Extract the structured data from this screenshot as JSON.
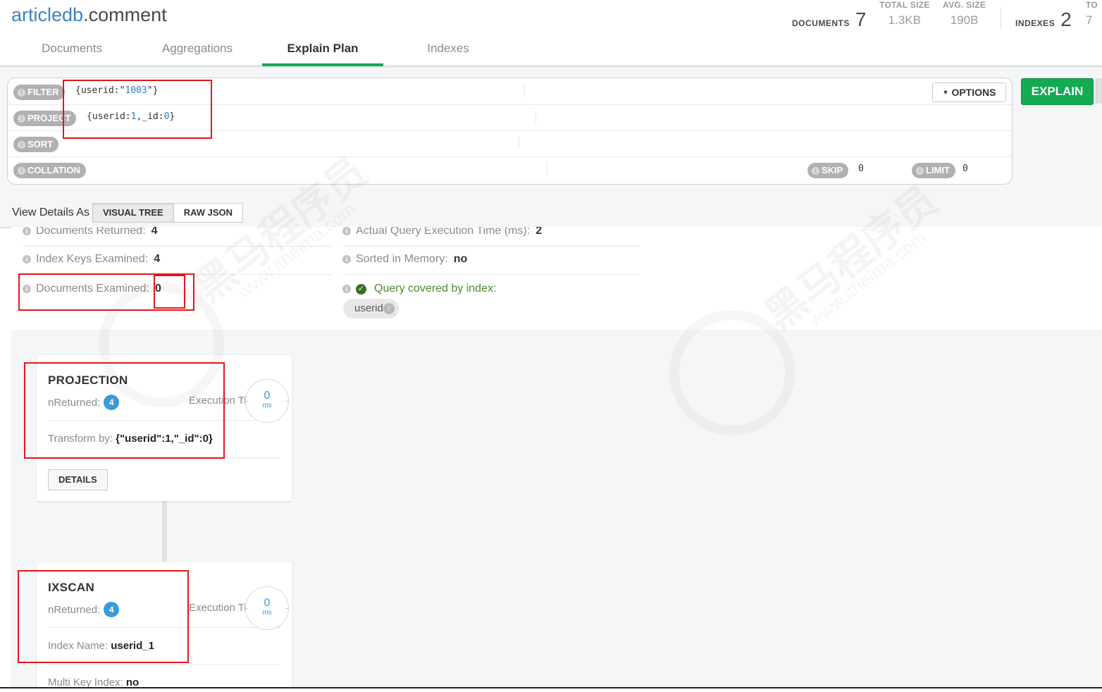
{
  "header": {
    "db": "articledb",
    "collection": ".comment",
    "stats": {
      "documents_label": "DOCUMENTS",
      "documents_value": "7",
      "total_size_label": "TOTAL SIZE",
      "total_size_value": "1.3KB",
      "avg_size_label": "AVG. SIZE",
      "avg_size_value": "190B",
      "indexes_label": "INDEXES",
      "indexes_value": "2",
      "cut_label": "TO",
      "cut_value": "7"
    }
  },
  "tabs": [
    {
      "label": "Documents",
      "active": false
    },
    {
      "label": "Aggregations",
      "active": false
    },
    {
      "label": "Explain Plan",
      "active": true
    },
    {
      "label": "Indexes",
      "active": false
    }
  ],
  "query": {
    "filter_label": "FILTER",
    "filter_value_pre": "{userid:\"",
    "filter_value_num": "1003",
    "filter_value_post": "\"}",
    "project_label": "PROJECT",
    "project_value_pre": "{userid:",
    "project_value_num1": "1",
    "project_value_mid": ",_id:",
    "project_value_num2": "0",
    "project_value_post": "}",
    "sort_label": "SORT",
    "collation_label": "COLLATION",
    "skip_label": "SKIP",
    "skip_value": "0",
    "limit_label": "LIMIT",
    "limit_value": "0",
    "options_label": "OPTIONS",
    "explain_label": "EXPLAIN"
  },
  "view_as": {
    "label": "View Details As",
    "visual_tree": "VISUAL TREE",
    "raw_json": "RAW JSON"
  },
  "summary": {
    "docs_returned_label": "Documents Returned:",
    "docs_returned_value": "4",
    "index_keys_label": "Index Keys Examined:",
    "index_keys_value": "4",
    "docs_examined_label": "Documents Examined:",
    "docs_examined_value": "0",
    "exec_time_label": "Actual Query Execution Time (ms):",
    "exec_time_value": "2",
    "sorted_label": "Sorted in Memory:",
    "sorted_value": "no",
    "covered_label": "Query covered by index:",
    "covered_index": "userid"
  },
  "stages": [
    {
      "name": "PROJECTION",
      "nreturned_label": "nReturned:",
      "nreturned": "4",
      "exec_label": "Execution Time:",
      "exec_value": "0",
      "exec_unit": "ms",
      "attr_label": "Transform by:",
      "attr_value": "{\"userid\":1,\"_id\":0}",
      "details_label": "DETAILS"
    },
    {
      "name": "IXSCAN",
      "nreturned_label": "nReturned:",
      "nreturned": "4",
      "exec_label": "Execution Time:",
      "exec_value": "0",
      "exec_unit": "ms",
      "attr_label": "Index Name:",
      "attr_value": "userid_1",
      "attr2_label": "Multi Key Index:",
      "attr2_value": "no"
    }
  ],
  "watermark": {
    "cn": "黑马程序员",
    "url": "www.itheima.com"
  },
  "colors": {
    "accent_green": "#13aa52",
    "link_blue": "#3d82bf",
    "badge_blue": "#3a9bd8",
    "annotation_red": "#e3161a"
  }
}
